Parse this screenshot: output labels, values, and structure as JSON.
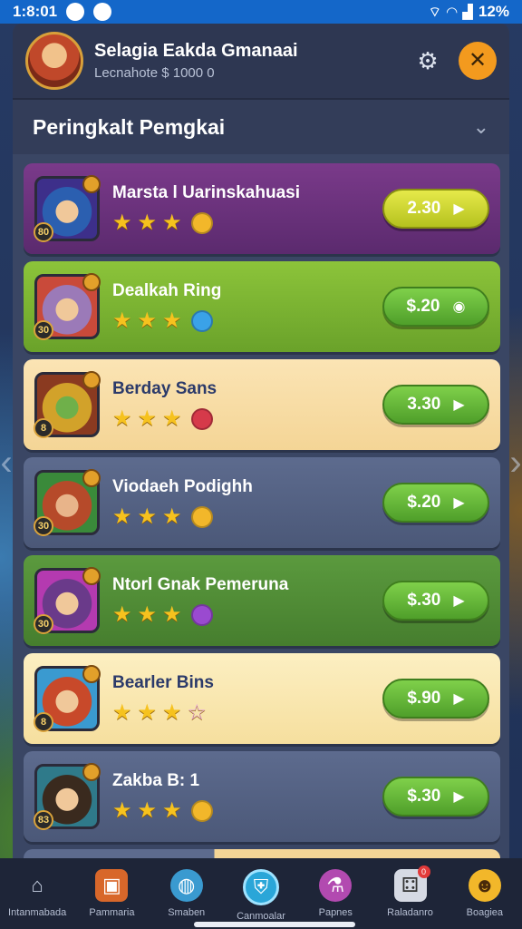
{
  "status_bar": {
    "time": "1:8:01",
    "battery": "12%"
  },
  "header": {
    "title": "Selagia Eakda Gmanaai",
    "subtitle": "Lecnahote $ 1000 0"
  },
  "section": {
    "title": "Peringkalt Pemgkai"
  },
  "players": [
    {
      "name": "Marsta l Uarinskahuasi",
      "price": "2.30",
      "stars": 3,
      "bonus_icon": "gold-crown-icon",
      "badge": "80"
    },
    {
      "name": "Dealkah Ring",
      "price": "$.20",
      "stars": 3,
      "bonus_icon": "blue-gem-icon",
      "badge": "30"
    },
    {
      "name": "Berday Sans",
      "price": "3.30",
      "stars": 3,
      "bonus_icon": "red-gem-icon",
      "badge": "8"
    },
    {
      "name": "Viodaeh Podighh",
      "price": "$.20",
      "stars": 3,
      "bonus_icon": "gold-crown-icon",
      "badge": "30"
    },
    {
      "name": "Ntorl Gnak Pemeruna",
      "price": "$.30",
      "stars": 3,
      "bonus_icon": "purple-gem-icon",
      "badge": "30"
    },
    {
      "name": "Bearler Bins",
      "price": "$.90",
      "stars": 3,
      "bonus_icon": "pink-star-icon",
      "badge": "8"
    },
    {
      "name": "Zakba B: 1",
      "price": "$.30",
      "stars": 3,
      "bonus_icon": "gold-crown-icon",
      "badge": "83"
    }
  ],
  "bottom_nav": [
    {
      "label": "Intanmabada",
      "icon": "home-icon"
    },
    {
      "label": "Pammaria",
      "icon": "treasure-chest-icon"
    },
    {
      "label": "Smaben",
      "icon": "globe-icon"
    },
    {
      "label": "Canmoalar",
      "icon": "shield-icon"
    },
    {
      "label": "Papnes",
      "icon": "potion-icon"
    },
    {
      "label": "Raladanro",
      "icon": "dice-icon",
      "notification": "0"
    },
    {
      "label": "Boagiea",
      "icon": "profile-icon"
    }
  ]
}
